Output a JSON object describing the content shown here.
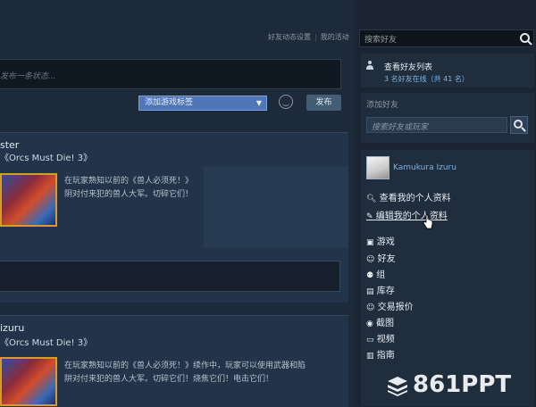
{
  "header": {
    "links": [
      "好友动态设置",
      "我的活动"
    ]
  },
  "status": {
    "placeholder": "发布一条状态..."
  },
  "post_toolbar": {
    "tag_select": "添加游戏标签",
    "post_label": "发布"
  },
  "feed": [
    {
      "user": "ster",
      "game": "《Orcs Must Die! 3》",
      "description": [
        "在玩家熟知以前的《兽人必须死！》",
        "阴对付来犯的兽人大军。切碎它们！"
      ]
    },
    {
      "user": "izuru",
      "game": "《Orcs Must Die! 3》",
      "description": [
        "在玩家熟知以前的《兽人必须死！》续作中，玩家可以使用武器和陷",
        "阱对付来犯的兽人大军。切碎它们！烧焦它们！电击它们！"
      ]
    }
  ],
  "sidebar": {
    "search_placeholder": "搜索好友",
    "friends": {
      "view_list": "查看好友列表",
      "online_count": "3 名好友在线（共 41 名）"
    },
    "add_friend": {
      "title": "添加好友",
      "placeholder": "搜索好友或玩家"
    },
    "profile": {
      "name": "Kamukura Izuru"
    },
    "menu": [
      {
        "label": "查看我的个人资料",
        "icon": "search-icon"
      },
      {
        "label": "编辑我的个人资料",
        "icon": "edit-icon"
      },
      {
        "label": "游戏",
        "icon": "game-icon"
      },
      {
        "label": "好友",
        "icon": "friend-icon"
      },
      {
        "label": "组",
        "icon": "group-icon"
      },
      {
        "label": "库存",
        "icon": "inventory-icon"
      },
      {
        "label": "交易报价",
        "icon": "trade-icon"
      },
      {
        "label": "截图",
        "icon": "camera-icon"
      },
      {
        "label": "视频",
        "icon": "video-icon"
      },
      {
        "label": "指南",
        "icon": "guide-icon"
      }
    ]
  },
  "watermark": "861PPT"
}
